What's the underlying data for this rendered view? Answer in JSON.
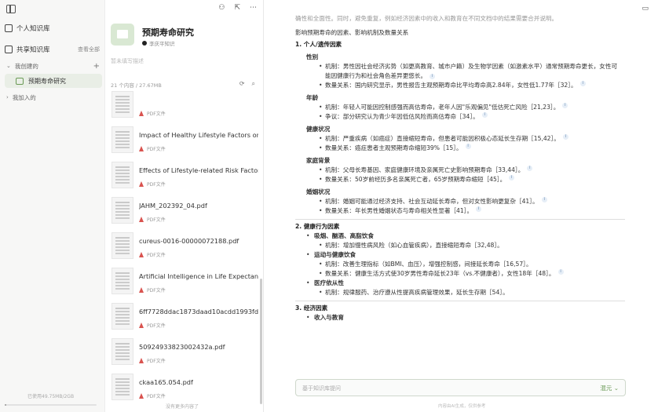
{
  "sidebar": {
    "personal_kb": "个人知识库",
    "shared_kb": "共享知识库",
    "shared_right": "查看全部",
    "my_created": "我创建的",
    "active_kb": "预期寿命研究",
    "joined": "我加入的",
    "storage": "已使用49.75MB/2GB",
    "storage_fraction": 0.02
  },
  "files": {
    "kb_title": "预期寿命研究",
    "kb_author": "李庆平知识",
    "kb_desc": "暂未填写描述",
    "count": "21 个内容 / 27.67MB",
    "items": [
      {
        "name": "",
        "type": "PDF文件"
      },
      {
        "name": "Impact of Healthy Lifestyle Factors on ...",
        "type": "PDF文件"
      },
      {
        "name": "Effects of Lifestyle-related Risk Factor...",
        "type": "PDF文件"
      },
      {
        "name": "JAHM_202392_04.pdf",
        "type": "PDF文件"
      },
      {
        "name": "cureus-0016-00000072188.pdf",
        "type": "PDF文件"
      },
      {
        "name": "Artificial Intelligence in Life Expectanc...",
        "type": "PDF文件"
      },
      {
        "name": "6ff7728ddac1873daad10acdd1993fdc...",
        "type": "PDF文件"
      },
      {
        "name": "50924933823002432a.pdf",
        "type": "PDF文件"
      },
      {
        "name": "ckaa165.054.pdf",
        "type": "PDF文件"
      }
    ],
    "footer": "没有更多内容了"
  },
  "content": {
    "faded_line": "确性和全面性。同时，避免重复，例如经济因素中的收入和教育在不同文档中的结果需要合并说明。",
    "intro": "影响预期寿命的因素、影响机制及数量关系",
    "sec1": "1. 个人/遗传因素",
    "gender": "性别",
    "gender_mech": "机制：男性因社会经济劣势（如更高教育、城市户籍）及生物学因素（如激素水平）通常预期寿命更长，女性可",
    "gender_mech2": "能因健康行为和社会角色差异更悠长。",
    "gender_num": "数量关系：国内研究显示，男性报告主观预期寿命比平均寿命高2.84年，女性低1.77年［32］。",
    "age": "年龄",
    "age_mech": "机制：年轻人可能因控制感强而高估寿命，老年人因\"乐观偏见\"低估死亡风险［21,23］。",
    "age_dispute": "争议：部分研究认为青少年因低估风险而高估寿命［34］。",
    "health": "健康状况",
    "health_mech": "机制：严重疾病（如癌症）直接缩短寿命，但患者可能因积极心态延长生存期［15,42］。",
    "health_num": "数量关系：癌症患者主观预期寿命缩短39%［15］。",
    "family": "家庭背景",
    "family_mech": "机制：父母长寿基因、家庭健康环境及亲属死亡史影响预期寿命［33,44］。",
    "family_num": "数量关系：50岁前经历多名亲属死亡者，65岁预期寿命缩短［45］。",
    "marriage": "婚姻状况",
    "marriage_mech": "机制：婚姻可能通过经济支持、社会互动延长寿命，但对女性影响更复杂［41］。",
    "marriage_num": "数量关系：年长男性婚姻状态与寿命相关性显著［41］。",
    "sec2": "2. 健康行为因素",
    "smoke": "吸烟、酗酒、高脂饮食",
    "smoke_mech": "机制：增加慢性病风险（如心血管疾病），直接缩短寿命［32,48］。",
    "exercise": "运动与健康饮食",
    "exercise_mech": "机制：改善生理指标（如BMI、血压），增强控制感，间接延长寿命［16,57］。",
    "exercise_num": "数量关系：健康生活方式使30岁男性寿命延长23年（vs.不健康者），女性18年［48］。",
    "medical": "医疗依从性",
    "medical_mech": "机制：规律服药、治疗遵从性提高疾病管理效果，延长生存期［54］。",
    "sec3": "3. 经济因素",
    "income": "收入与教育",
    "ask_placeholder": "基于知识库提问",
    "ask_mode": "混元",
    "bottom_note": "内容由AI生成，仅供参考"
  }
}
